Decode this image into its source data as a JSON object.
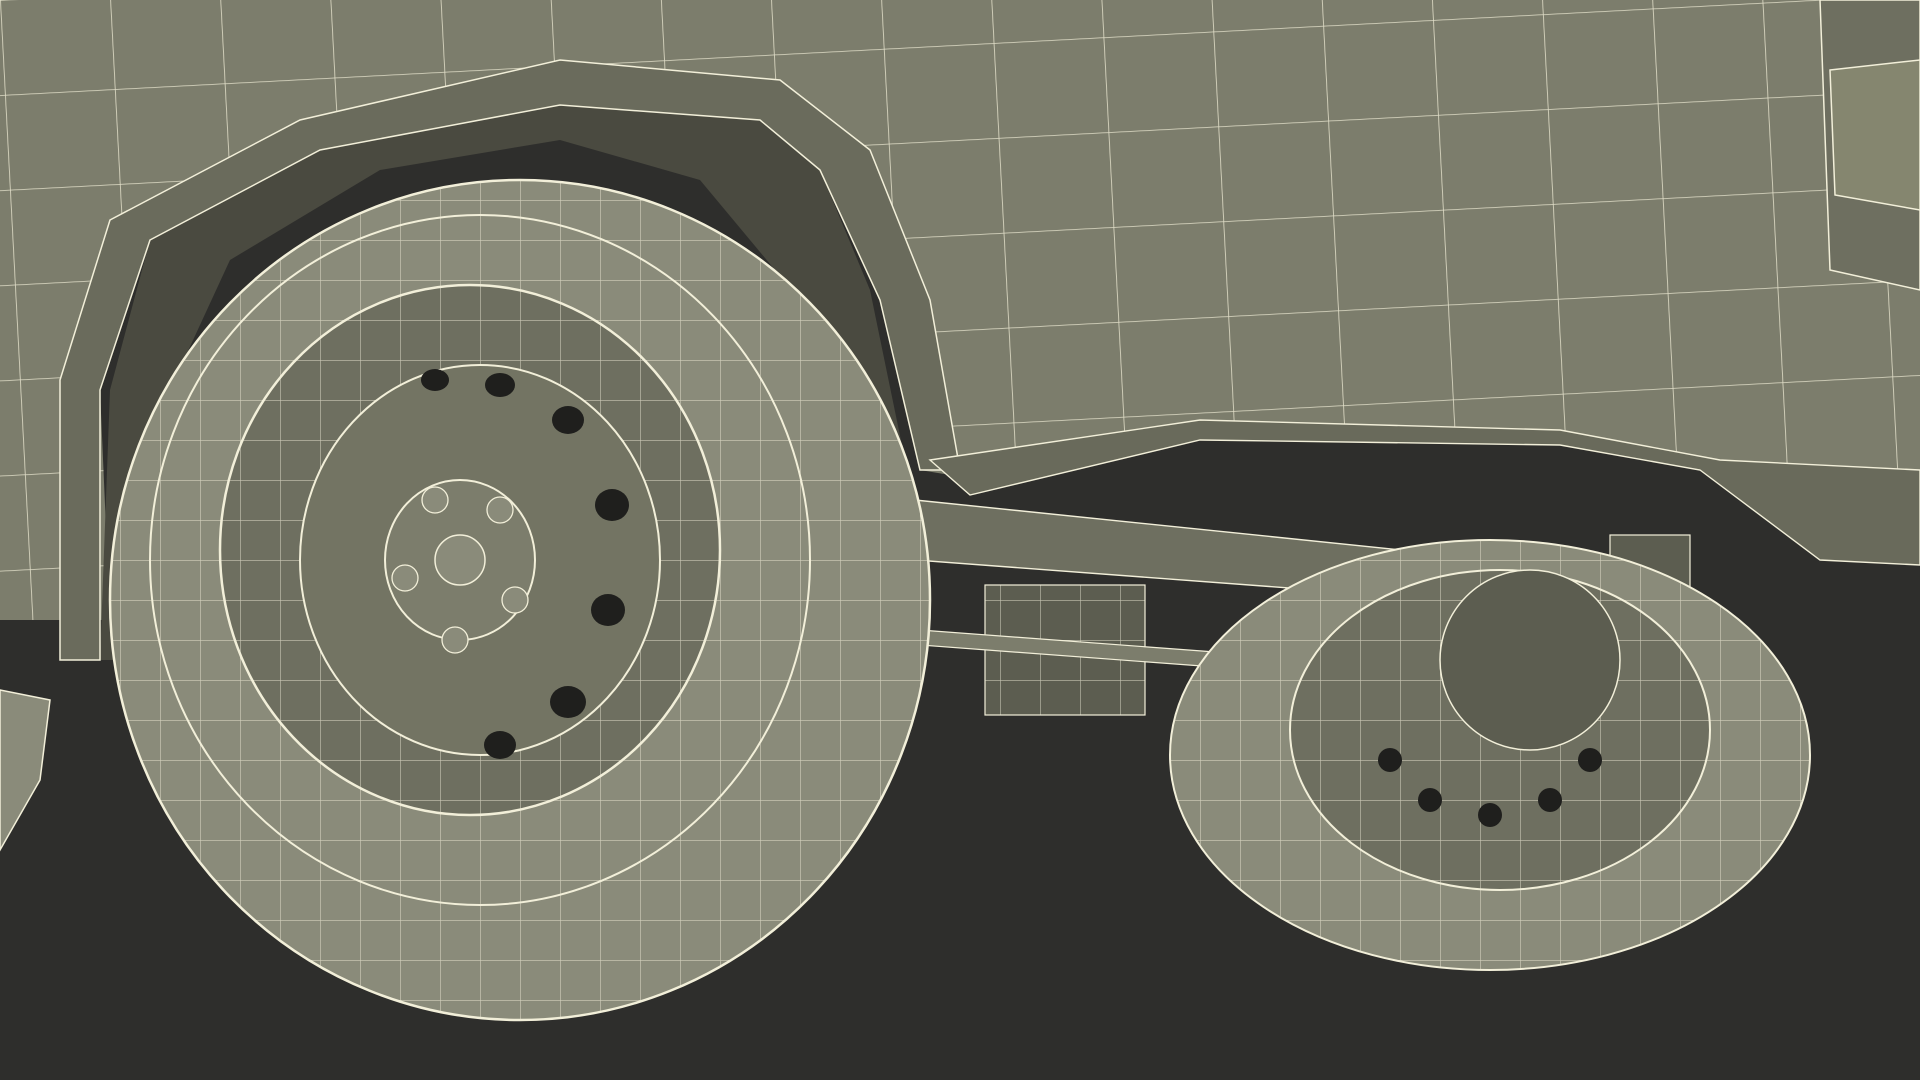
{
  "scene": {
    "subject": "truck-rear-wheels-wireframe",
    "colors": {
      "background": "#2e2e2c",
      "body": "#7c7d6c",
      "body_dark": "#5c5d50",
      "body_shadow": "#4a4a40",
      "wire": "#f2efd9",
      "tire": "#8a8b7a",
      "hub": "#6e6f60",
      "hole": "#1f1f1d"
    }
  }
}
